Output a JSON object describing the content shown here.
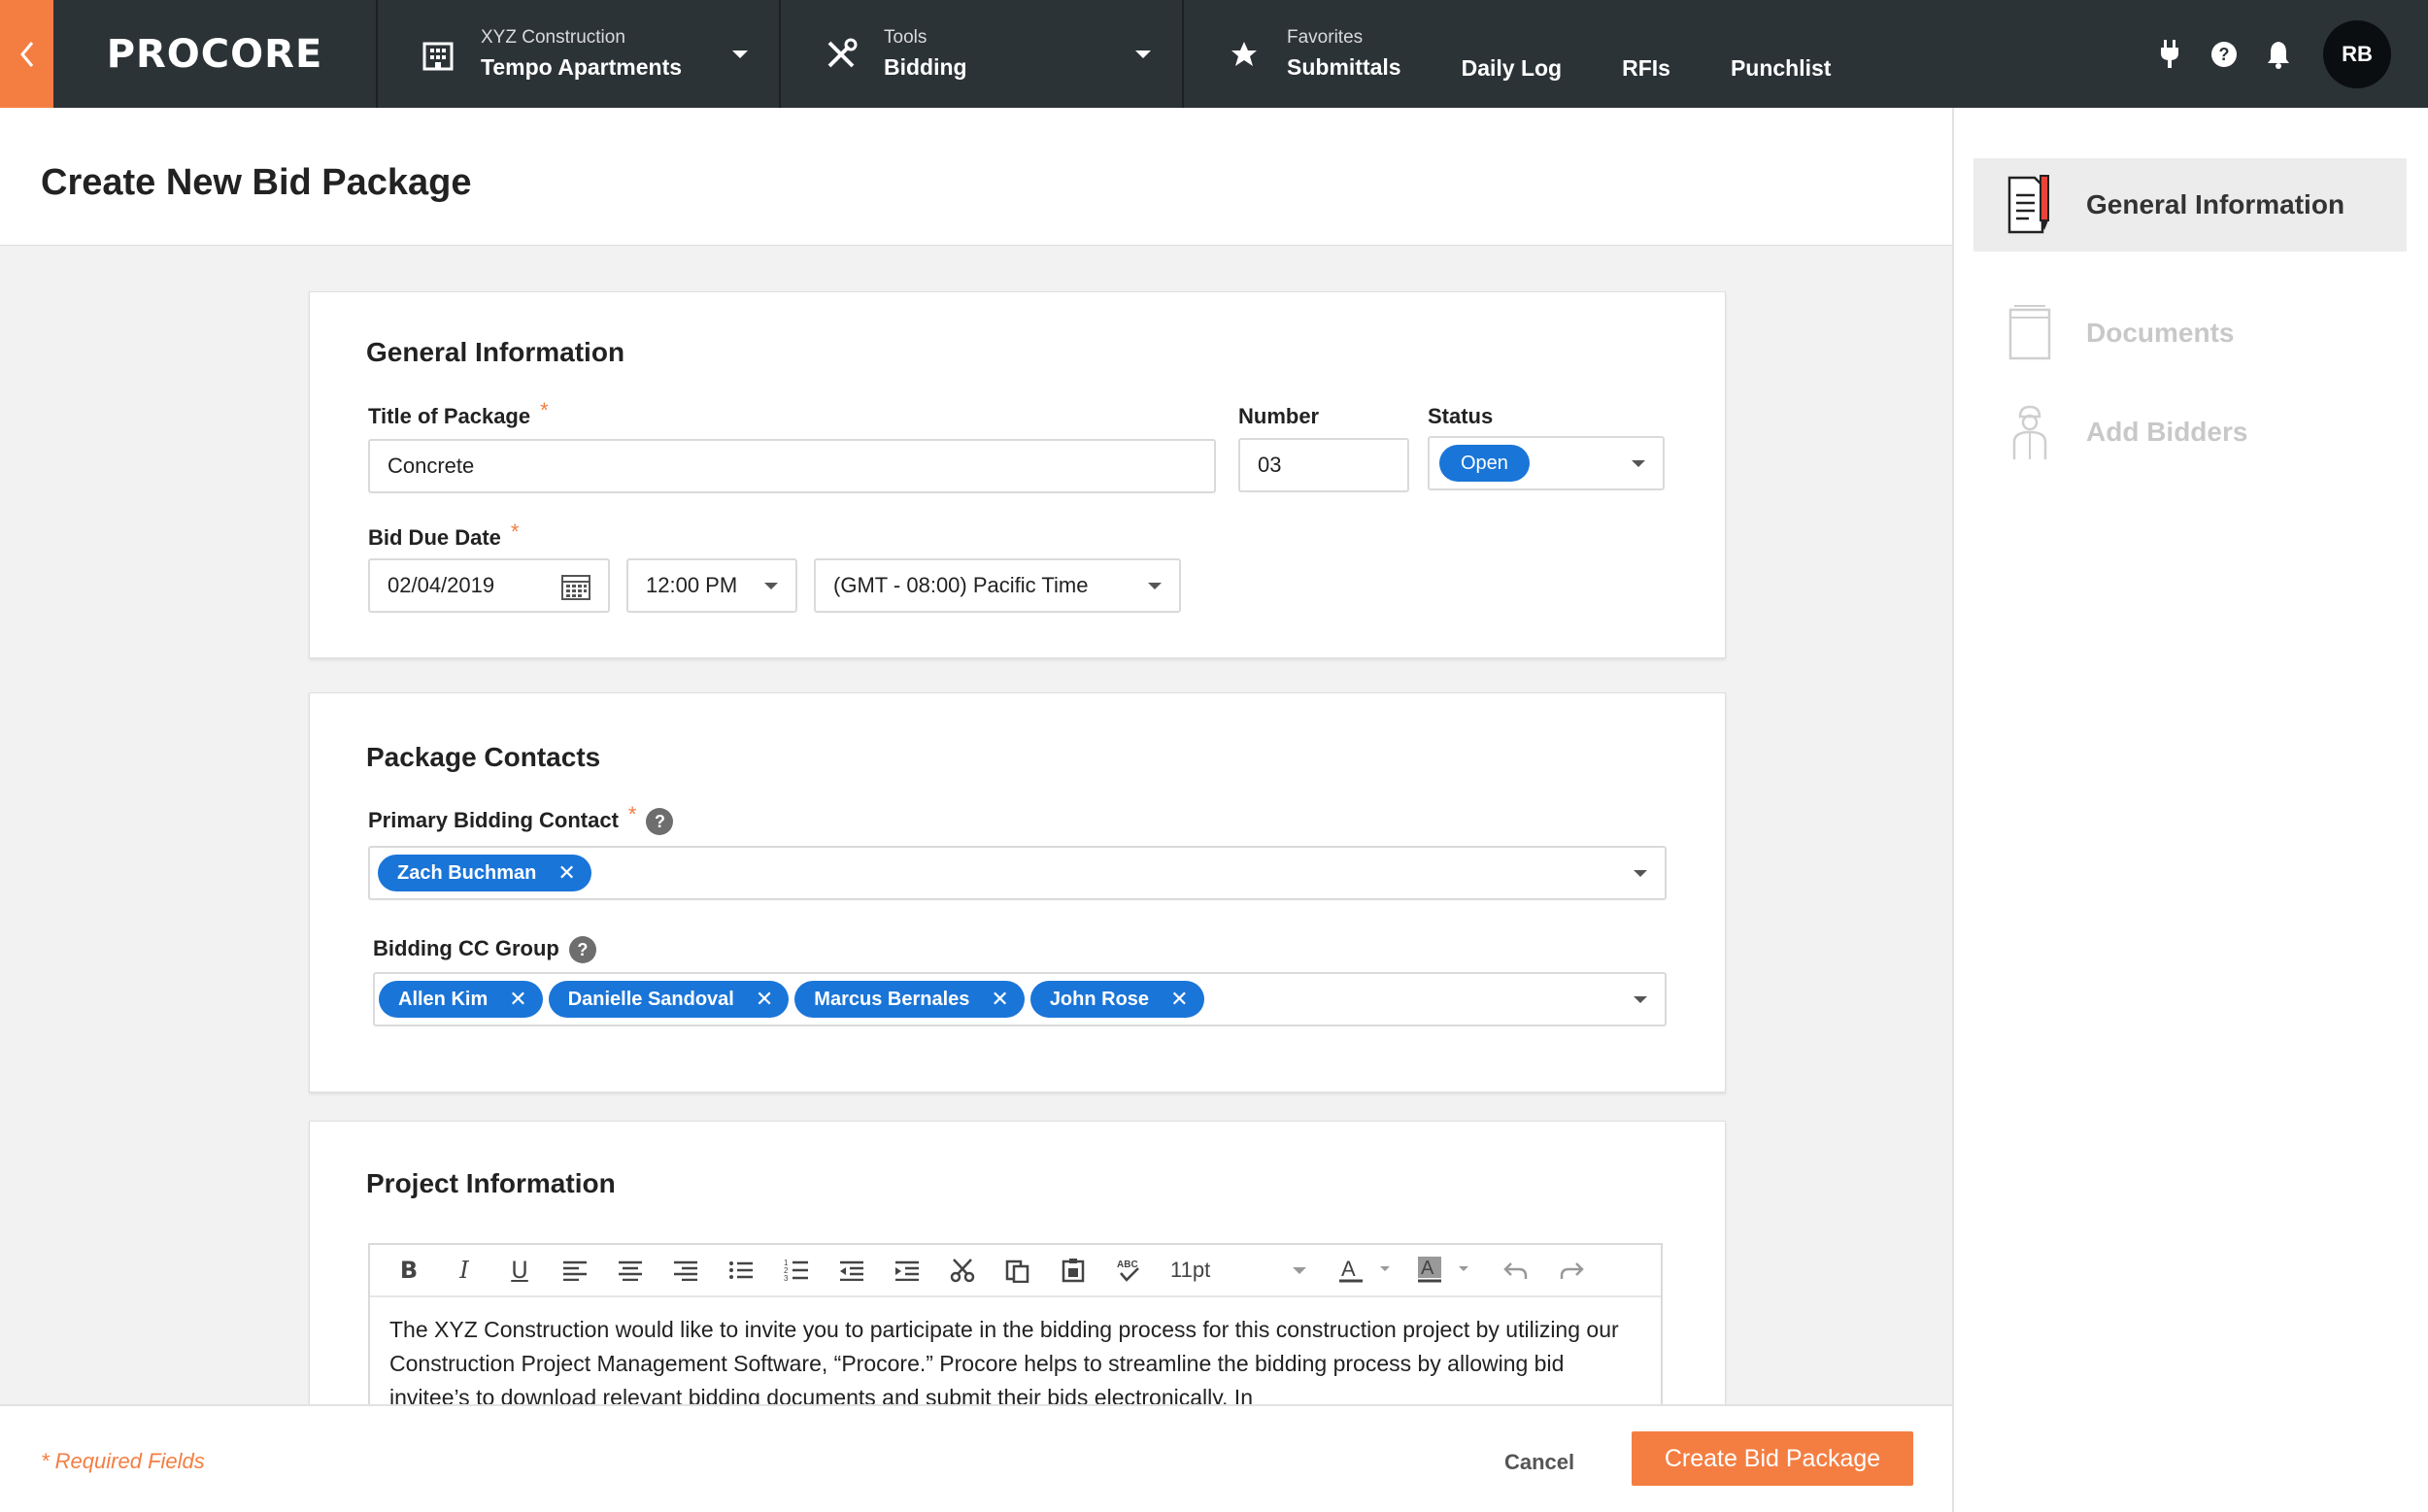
{
  "nav": {
    "logo": "PROCORE",
    "project": {
      "small": "XYZ Construction",
      "big": "Tempo Apartments"
    },
    "tools": {
      "small": "Tools",
      "big": "Bidding"
    },
    "favorites": {
      "small": "Favorites",
      "big": "Submittals",
      "links": [
        "Daily Log",
        "RFIs",
        "Punchlist"
      ]
    },
    "avatar": "RB"
  },
  "page": {
    "title": "Create New Bid Package"
  },
  "sidebar": {
    "items": [
      {
        "label": "General Information",
        "icon": "document-pencil-icon",
        "active": true
      },
      {
        "label": "Documents",
        "icon": "documents-icon",
        "active": false
      },
      {
        "label": "Add Bidders",
        "icon": "worker-icon",
        "active": false
      }
    ]
  },
  "general": {
    "title": "General Information",
    "title_label": "Title of Package",
    "title_value": "Concrete",
    "number_label": "Number",
    "number_value": "03",
    "status_label": "Status",
    "status_value": "Open",
    "due_label": "Bid Due Date",
    "due_date": "02/04/2019",
    "due_time": "12:00 PM",
    "timezone": "(GMT - 08:00) Pacific Time",
    "required_mark": "*"
  },
  "contacts": {
    "title": "Package Contacts",
    "primary_label": "Primary Bidding Contact",
    "primary": [
      "Zach Buchman"
    ],
    "cc_label": "Bidding CC Group",
    "cc": [
      "Allen Kim",
      "Danielle Sandoval",
      "Marcus Bernales",
      "John Rose"
    ],
    "help": "?"
  },
  "project_info": {
    "title": "Project Information",
    "font_size": "11pt",
    "body": "The XYZ Construction would like to invite you to participate in the bidding process for this construction project by utilizing our Construction Project Management Software, “Procore.” Procore helps to streamline the bidding process by allowing bid invitee’s to download relevant bidding documents and submit their bids electronically. In"
  },
  "footer": {
    "required_note": "* Required Fields",
    "cancel": "Cancel",
    "create": "Create Bid Package"
  },
  "colors": {
    "accent": "#f47e42",
    "pill": "#1a75d8",
    "nav_bg": "#2c3337"
  }
}
